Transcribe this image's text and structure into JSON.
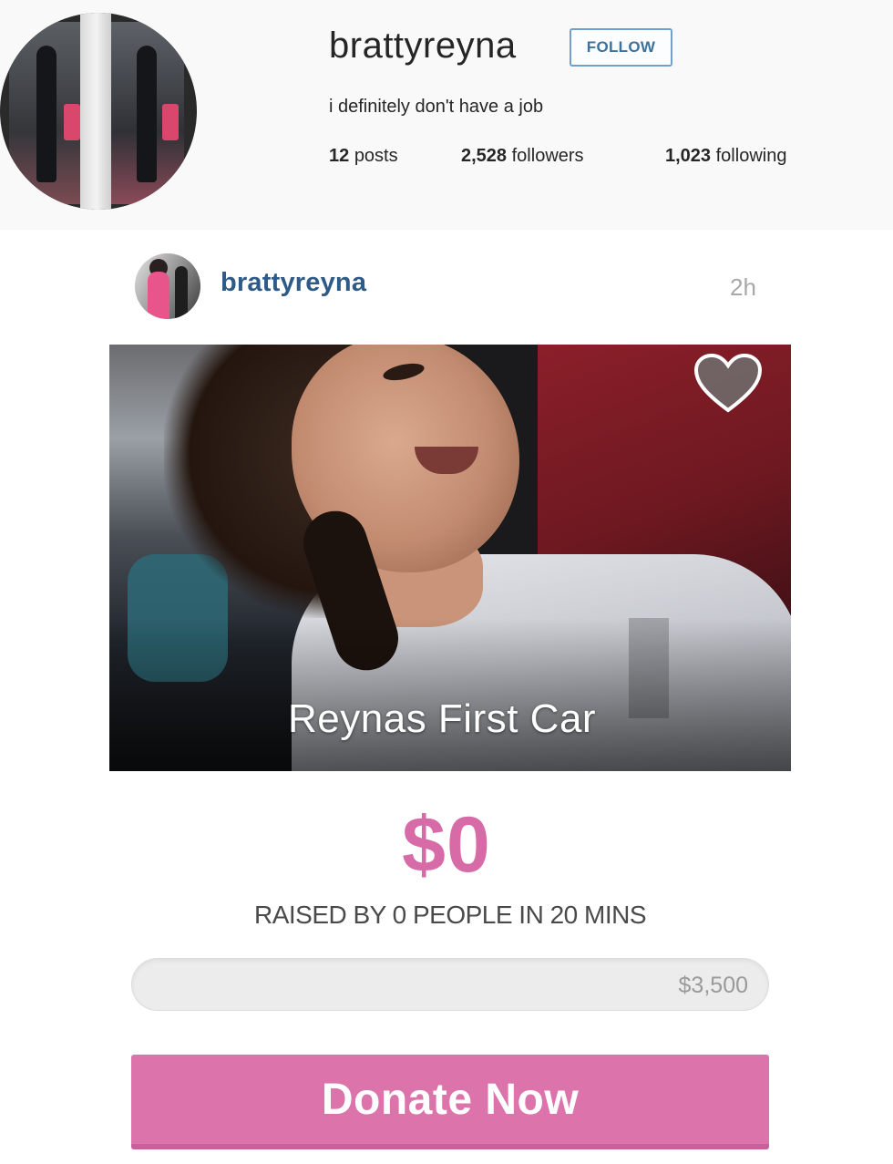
{
  "profile": {
    "username": "brattyreyna",
    "follow_label": "FOLLOW",
    "bio": "i definitely don't have a job",
    "stats": [
      {
        "count": "12",
        "label": "posts"
      },
      {
        "count": "2,528",
        "label": "followers"
      },
      {
        "count": "1,023",
        "label": "following"
      }
    ]
  },
  "post": {
    "username": "brattyreyna",
    "time": "2h",
    "campaign_title": "Reynas First Car",
    "raised_amount": "$0",
    "raised_caption": "RAISED BY 0 PEOPLE IN 20 MINS",
    "goal": "$3,500",
    "progress_fraction": 0,
    "donate_label": "Donate Now"
  },
  "colors": {
    "accent_pink": "#dd73ab",
    "link_blue": "#2d5a86"
  },
  "icons": {
    "heart": "heart-icon"
  }
}
